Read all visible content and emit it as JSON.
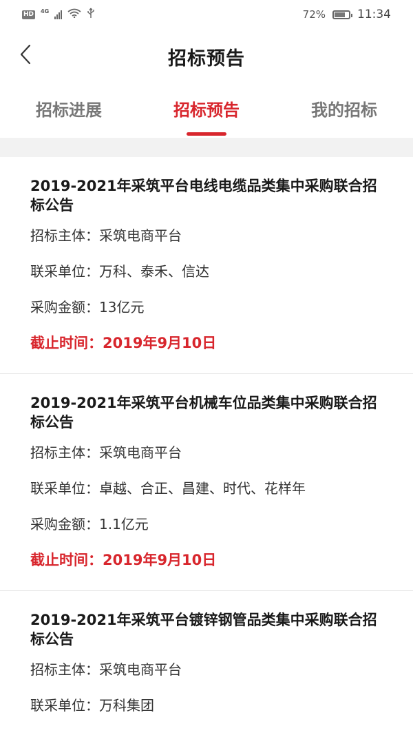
{
  "status_bar": {
    "hd": "HD",
    "network": "4G",
    "battery_percent": "72%",
    "time": "11:34"
  },
  "header": {
    "title": "招标预告",
    "back_icon": "chevron-left-icon"
  },
  "tabs": [
    {
      "label": "招标进展",
      "active": false
    },
    {
      "label": "招标预告",
      "active": true
    },
    {
      "label": "我的招标",
      "active": false
    }
  ],
  "accent_color": "#d8262d",
  "labels": {
    "subject": "招标主体：",
    "units": "联采单位：",
    "amount": "采购金额：",
    "deadline": "截止时间："
  },
  "announcements": [
    {
      "title": "2019-2021年采筑平台电线电缆品类集中采购联合招标公告",
      "subject": "采筑电商平台",
      "units": "万科、泰禾、信达",
      "amount": "13亿元",
      "deadline": "2019年9月10日"
    },
    {
      "title": "2019-2021年采筑平台机械车位品类集中采购联合招标公告",
      "subject": "采筑电商平台",
      "units": "卓越、合正、昌建、时代、花样年",
      "amount": "1.1亿元",
      "deadline": "2019年9月10日"
    },
    {
      "title": "2019-2021年采筑平台镀锌钢管品类集中采购联合招标公告",
      "subject": "采筑电商平台",
      "units": "万科集团"
    }
  ]
}
